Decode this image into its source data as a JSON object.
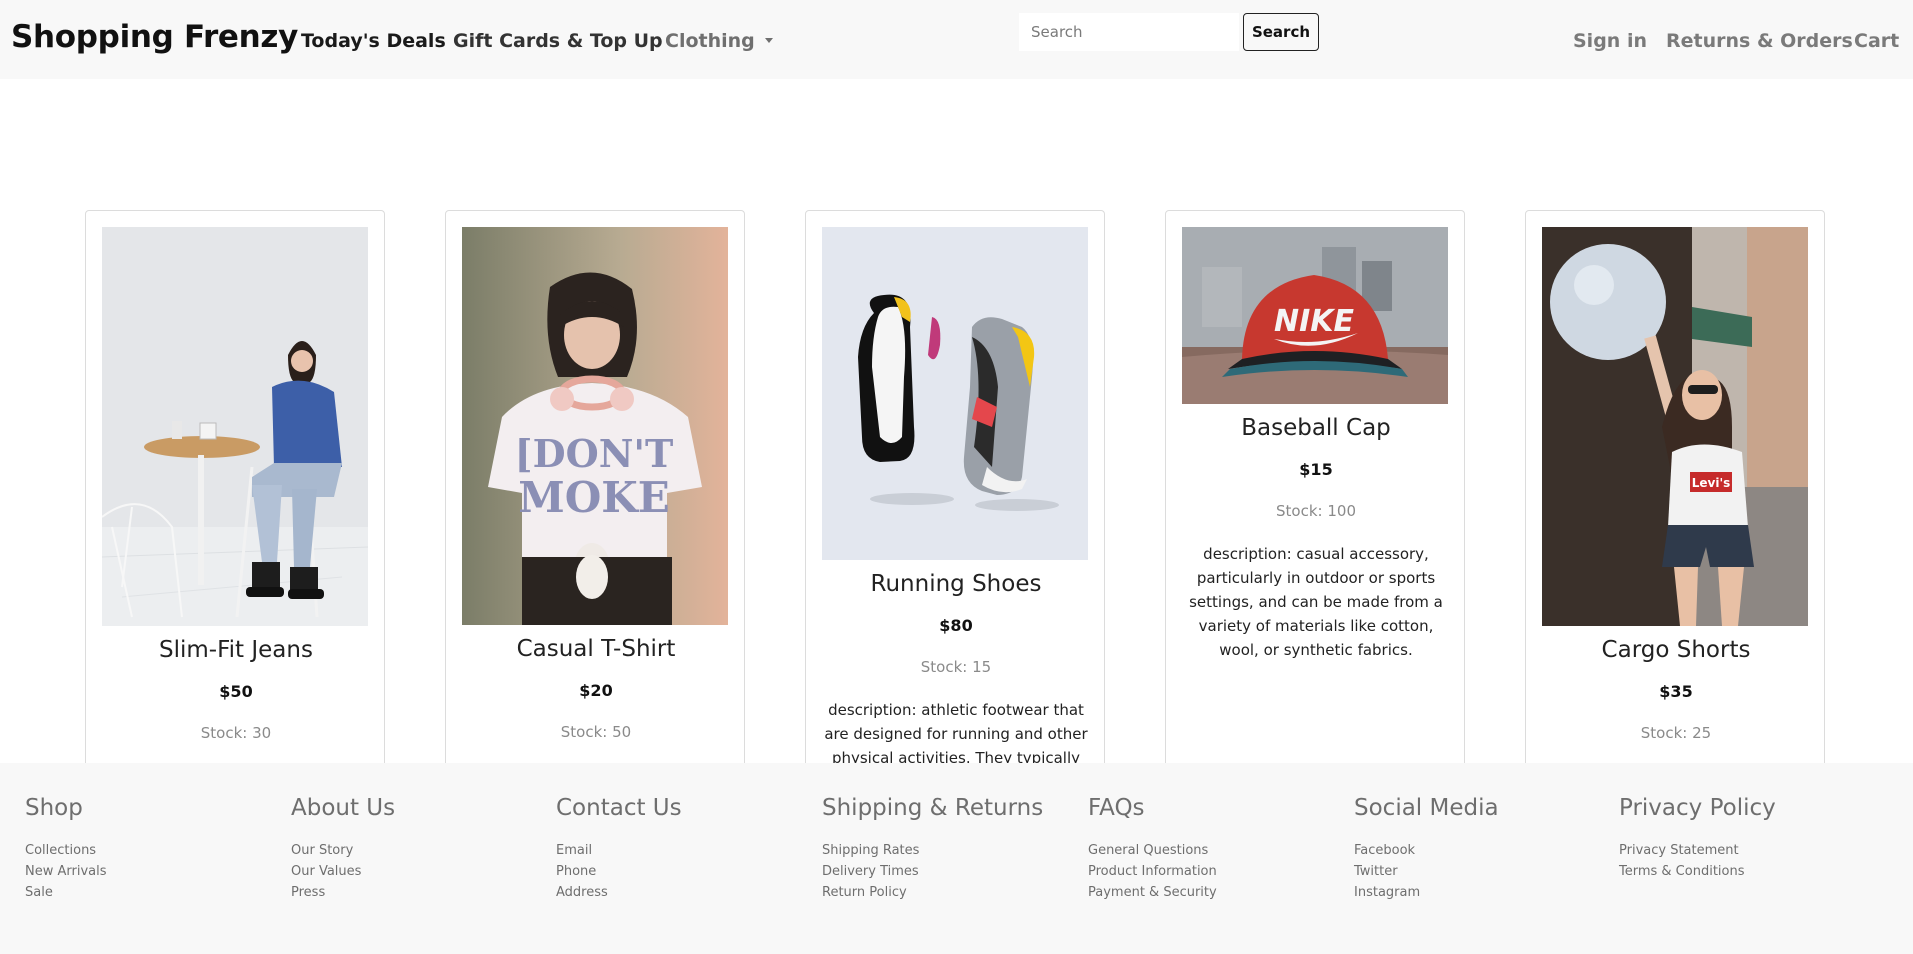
{
  "navbar": {
    "brand": "Shopping Frenzy",
    "links": {
      "deals": "Today's Deals",
      "gift": "Gift Cards & Top Up",
      "clothing": "Clothing"
    },
    "search": {
      "placeholder": "Search",
      "value": "",
      "button": "Search"
    },
    "right": {
      "signin": "Sign in",
      "returns": "Returns & Orders",
      "cart": "Cart"
    }
  },
  "products": [
    {
      "title": "Slim-Fit Jeans",
      "price": "$50",
      "stock": "Stock: 30",
      "description": ""
    },
    {
      "title": "Casual T-Shirt",
      "price": "$20",
      "stock": "Stock: 50",
      "description": ""
    },
    {
      "title": "Running Shoes",
      "price": "$80",
      "stock": "Stock: 15",
      "description": "description: athletic footwear that are designed for running and other physical activities. They typically have"
    },
    {
      "title": "Baseball Cap",
      "price": "$15",
      "stock": "Stock: 100",
      "description": "description: casual accessory, particularly in outdoor or sports settings, and can be made from a variety of materials like cotton, wool, or synthetic fabrics.",
      "image_text": "NIKE"
    },
    {
      "title": "Cargo Shorts",
      "price": "$35",
      "stock": "Stock: 25",
      "description": "",
      "image_text": "Levi's"
    }
  ],
  "footer": {
    "columns": [
      {
        "title": "Shop",
        "items": [
          "Collections",
          "New Arrivals",
          "Sale"
        ]
      },
      {
        "title": "About Us",
        "items": [
          "Our Story",
          "Our Values",
          "Press"
        ]
      },
      {
        "title": "Contact Us",
        "items": [
          "Email",
          "Phone",
          "Address"
        ]
      },
      {
        "title": "Shipping & Returns",
        "items": [
          "Shipping Rates",
          "Delivery Times",
          "Return Policy"
        ]
      },
      {
        "title": "FAQs",
        "items": [
          "General Questions",
          "Product Information",
          "Payment & Security"
        ]
      },
      {
        "title": "Social Media",
        "items": [
          "Facebook",
          "Twitter",
          "Instagram"
        ]
      },
      {
        "title": "Privacy Policy",
        "items": [
          "Privacy Statement",
          "Terms & Conditions"
        ]
      }
    ]
  }
}
